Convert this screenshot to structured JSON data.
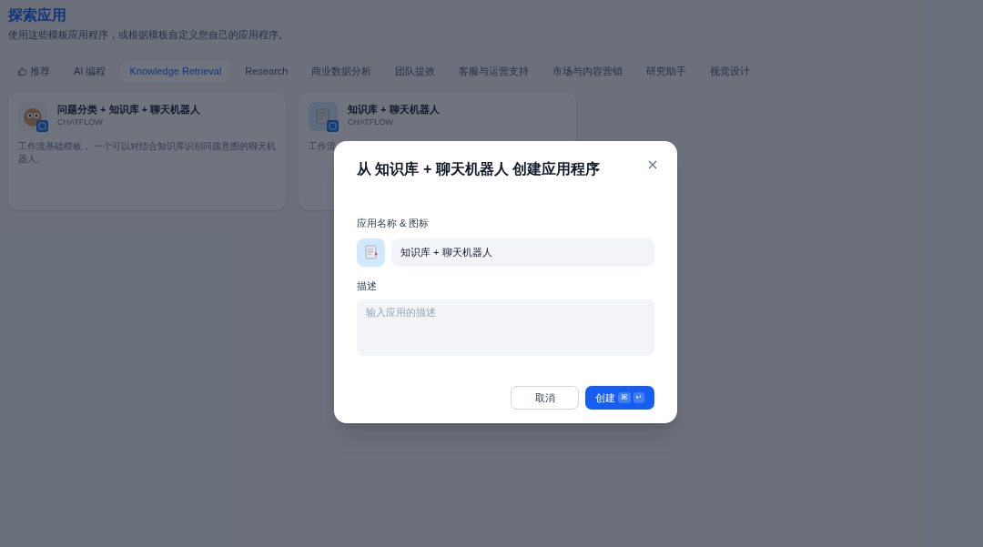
{
  "page": {
    "title": "探索应用",
    "subtitle": "使用这些模板应用程序，或根据模板自定义您自己的应用程序。"
  },
  "tabs": [
    {
      "label": "推荐",
      "kind": "icon",
      "selected": false
    },
    {
      "label": "AI 编程",
      "kind": "text",
      "selected": false
    },
    {
      "label": "Knowledge Retrieval",
      "kind": "text",
      "selected": true
    },
    {
      "label": "Research",
      "kind": "text",
      "selected": false
    },
    {
      "label": "商业数据分析",
      "kind": "text",
      "selected": false
    },
    {
      "label": "团队提效",
      "kind": "text",
      "selected": false
    },
    {
      "label": "客服与运营支持",
      "kind": "text",
      "selected": false
    },
    {
      "label": "市场与内容营销",
      "kind": "text",
      "selected": false
    },
    {
      "label": "研究助手",
      "kind": "text",
      "selected": false
    },
    {
      "label": "视觉设计",
      "kind": "text",
      "selected": false
    }
  ],
  "cards": [
    {
      "title": "问题分类 + 知识库 + 聊天机器人",
      "type": "CHATFLOW",
      "description": "工作流基础模板， 一个可以对结合知识库识别问题意图的聊天机器人。",
      "kind": "avatar"
    },
    {
      "title": "知识库 + 聊天机器人",
      "type": "CHATFLOW",
      "description": "工作流",
      "kind": "document"
    }
  ],
  "dialog": {
    "title": "从 知识库 + 聊天机器人 创建应用程序",
    "name_label": "应用名称 & 图标",
    "name_value": "知识库 + 聊天机器人",
    "description_label": "描述",
    "description_placeholder": "输入应用的描述",
    "cancel": "取消",
    "create": "创建",
    "shortcut_keys": [
      "⌘",
      "↵"
    ]
  }
}
